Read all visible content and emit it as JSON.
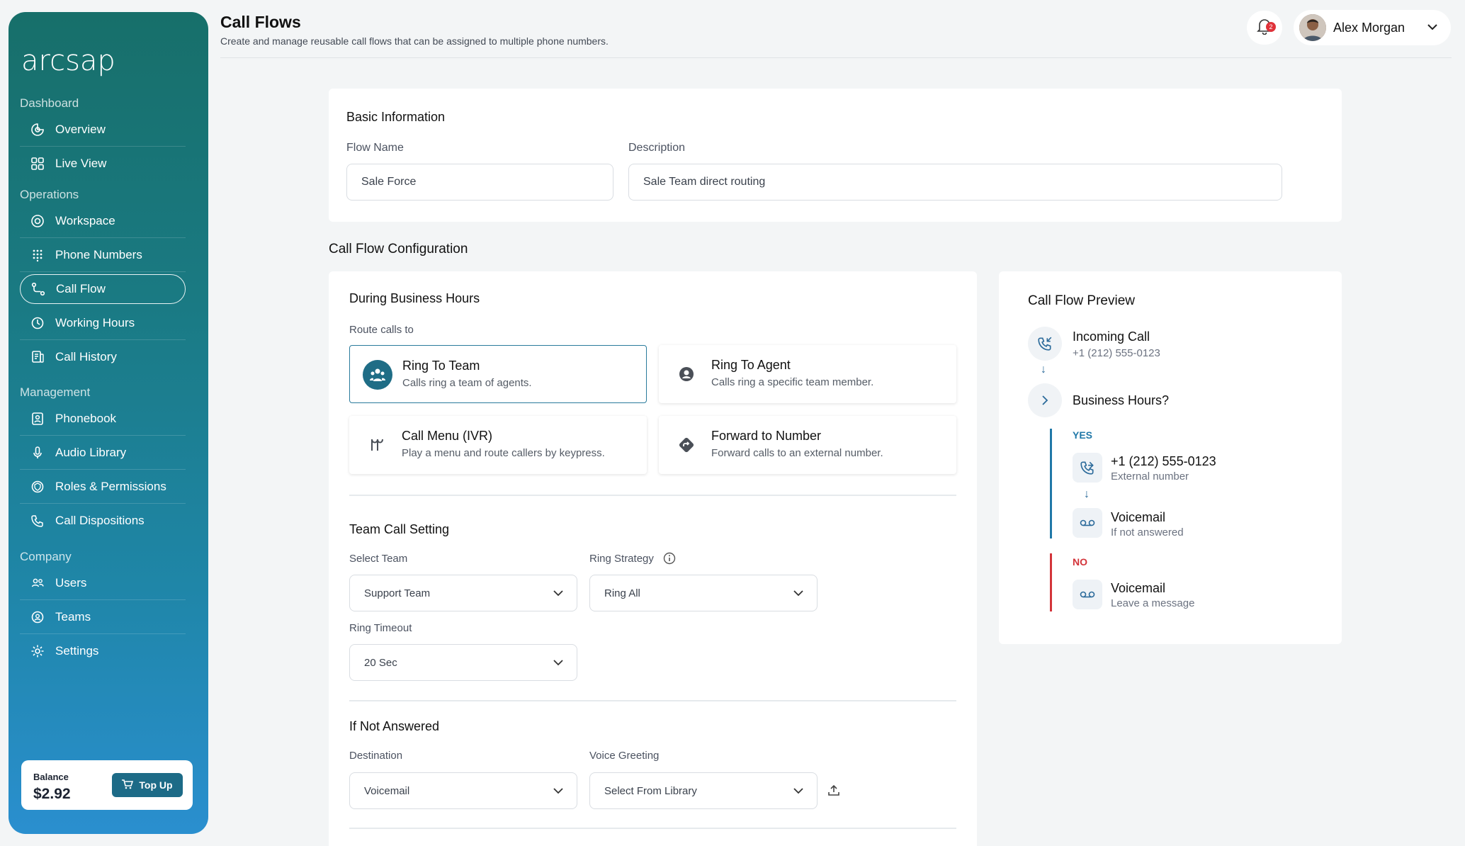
{
  "brand": {
    "logo_text": "arcsap"
  },
  "sidebar": {
    "groups": [
      {
        "title": "Dashboard",
        "items": [
          {
            "label": "Overview",
            "icon": "overview-icon"
          },
          {
            "label": "Live View",
            "icon": "grid-icon"
          }
        ]
      },
      {
        "title": "Operations",
        "items": [
          {
            "label": "Workspace",
            "icon": "workspace-icon"
          },
          {
            "label": "Phone Numbers",
            "icon": "dialpad-icon"
          },
          {
            "label": "Call Flow",
            "icon": "call-flow-icon",
            "active": true
          },
          {
            "label": "Working Hours",
            "icon": "clock-icon"
          },
          {
            "label": "Call History",
            "icon": "history-icon"
          }
        ]
      },
      {
        "title": "Management",
        "items": [
          {
            "label": "Phonebook",
            "icon": "phonebook-icon"
          },
          {
            "label": "Audio Library",
            "icon": "microphone-icon"
          },
          {
            "label": "Roles & Permissions",
            "icon": "shield-icon"
          },
          {
            "label": "Call Dispositions",
            "icon": "phone-icon"
          }
        ]
      },
      {
        "title": "Company",
        "items": [
          {
            "label": "Users",
            "icon": "users-icon"
          },
          {
            "label": "Teams",
            "icon": "teams-icon"
          },
          {
            "label": "Settings",
            "icon": "gear-icon"
          }
        ]
      }
    ],
    "balance": {
      "label": "Balance",
      "amount": "$2.92",
      "topup_label": "Top Up"
    }
  },
  "header": {
    "title": "Call Flows",
    "subtitle": "Create and manage reusable call flows that can be assigned to multiple phone numbers.",
    "notification_count": "2",
    "user_name": "Alex Morgan"
  },
  "basic_info": {
    "title": "Basic Information",
    "flow_name_label": "Flow Name",
    "flow_name_value": "Sale Force",
    "description_label": "Description",
    "description_value": "Sale Team direct routing"
  },
  "config": {
    "title": "Call Flow Configuration",
    "business_hours_title": "During Business Hours",
    "route_label": "Route calls to",
    "options": [
      {
        "title": "Ring To Team",
        "desc": "Calls ring a team of agents.",
        "icon": "team-icon",
        "selected": true
      },
      {
        "title": "Ring To Agent",
        "desc": "Calls ring a specific team member.",
        "icon": "agent-icon",
        "selected": false
      },
      {
        "title": "Call Menu (IVR)",
        "desc": "Play a menu and route callers by keypress.",
        "icon": "ivr-icon",
        "selected": false
      },
      {
        "title": "Forward to Number",
        "desc": "Forward calls to an external number.",
        "icon": "forward-icon",
        "selected": false
      }
    ],
    "team_setting": {
      "title": "Team Call Setting",
      "select_team_label": "Select Team",
      "select_team_value": "Support Team",
      "ring_strategy_label": "Ring Strategy",
      "ring_strategy_value": "Ring All",
      "ring_timeout_label": "Ring Timeout",
      "ring_timeout_value": "20 Sec"
    },
    "not_answered": {
      "title": "If Not Answered",
      "destination_label": "Destination",
      "destination_value": "Voicemail",
      "greeting_label": "Voice Greeting",
      "greeting_value": "Select From Library"
    }
  },
  "preview": {
    "title": "Call Flow Preview",
    "incoming_title": "Incoming Call",
    "incoming_number": "+1 (212) 555-0123",
    "condition": "Business Hours?",
    "yes_label": "YES",
    "yes_step1_title": "+1 (212) 555-0123",
    "yes_step1_sub": "External number",
    "yes_step2_title": "Voicemail",
    "yes_step2_sub": "If not answered",
    "no_label": "NO",
    "no_step_title": "Voicemail",
    "no_step_sub": "Leave a message"
  },
  "colors": {
    "accent": "#2a7b9c",
    "sidebar_top": "#176f6a",
    "sidebar_bottom": "#2a8fcf",
    "yes": "#2078a8",
    "no": "#d3343a"
  }
}
